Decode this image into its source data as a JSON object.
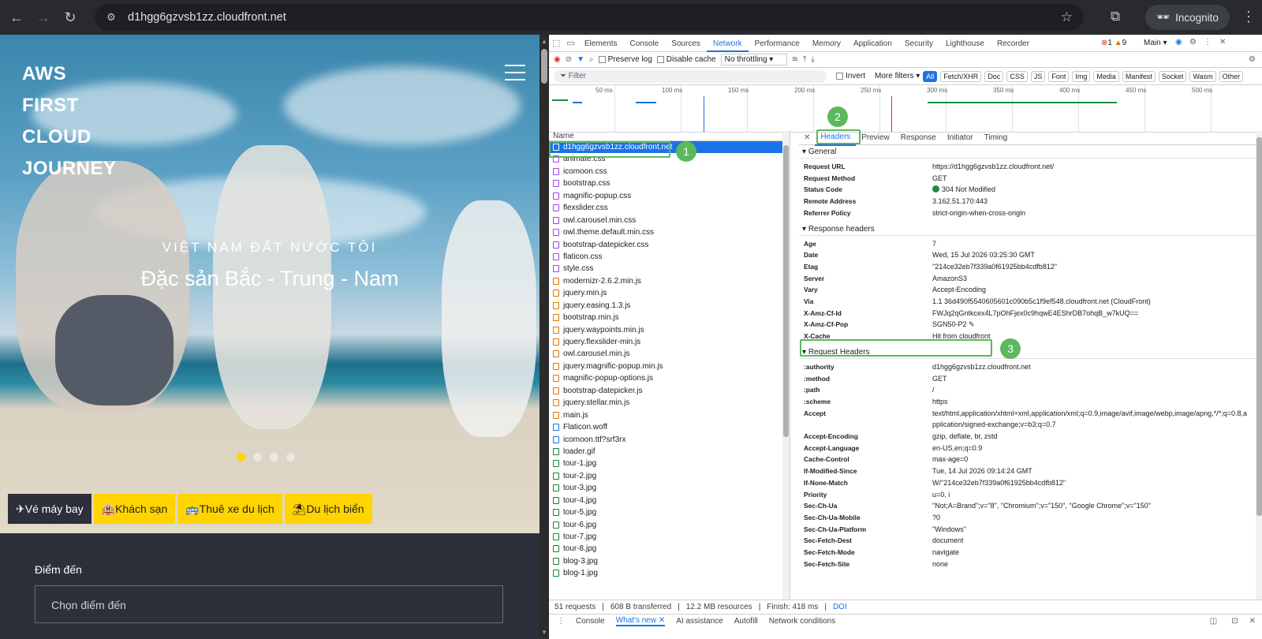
{
  "browser": {
    "url": "d1hgg6gzvsb1zz.cloudfront.net",
    "incognito_label": "Incognito"
  },
  "page": {
    "logo_lines": [
      "AWS",
      "FIRST",
      "CLOUD",
      "JOURNEY"
    ],
    "tagline": "VIỆT NAM ĐẤT NƯỚC TÔI",
    "hero_title": "Đặc sản Bắc - Trung - Nam",
    "tabs": [
      "✈Vé máy bay",
      "🏨Khách sạn",
      "🚌Thuê xe du lịch",
      "⛱Du lịch biển"
    ],
    "form_label": "Điểm đến",
    "form_placeholder": "Chọn điểm đến"
  },
  "devtools": {
    "tabs": [
      "Elements",
      "Console",
      "Sources",
      "Network",
      "Performance",
      "Memory",
      "Application",
      "Security",
      "Lighthouse",
      "Recorder"
    ],
    "errors": "1",
    "warnings": "9",
    "context": "Main",
    "toolbar": {
      "preserve_log": "Preserve log",
      "disable_cache": "Disable cache",
      "throttling": "No throttling"
    },
    "filter": {
      "placeholder": "Filter",
      "invert": "Invert",
      "more_filters": "More filters",
      "types": [
        "All",
        "Fetch/XHR",
        "Doc",
        "CSS",
        "JS",
        "Font",
        "Img",
        "Media",
        "Manifest",
        "Socket",
        "Wasm",
        "Other"
      ]
    },
    "ticks": [
      "50 ms",
      "100 ms",
      "150 ms",
      "200 ms",
      "250 ms",
      "300 ms",
      "350 ms",
      "400 ms",
      "450 ms",
      "500 ms"
    ],
    "list_header": "Name",
    "requests": [
      {
        "name": "d1hgg6gzvsb1zz.cloudfront.net",
        "type": "doc"
      },
      {
        "name": "animate.css",
        "type": "css"
      },
      {
        "name": "icomoon.css",
        "type": "css"
      },
      {
        "name": "bootstrap.css",
        "type": "css"
      },
      {
        "name": "magnific-popup.css",
        "type": "css"
      },
      {
        "name": "flexslider.css",
        "type": "css"
      },
      {
        "name": "owl.carousel.min.css",
        "type": "css"
      },
      {
        "name": "owl.theme.default.min.css",
        "type": "css"
      },
      {
        "name": "bootstrap-datepicker.css",
        "type": "css"
      },
      {
        "name": "flaticon.css",
        "type": "css"
      },
      {
        "name": "style.css",
        "type": "css"
      },
      {
        "name": "modernizr-2.6.2.min.js",
        "type": "js"
      },
      {
        "name": "jquery.min.js",
        "type": "js"
      },
      {
        "name": "jquery.easing.1.3.js",
        "type": "js"
      },
      {
        "name": "bootstrap.min.js",
        "type": "js"
      },
      {
        "name": "jquery.waypoints.min.js",
        "type": "js"
      },
      {
        "name": "jquery.flexslider-min.js",
        "type": "js"
      },
      {
        "name": "owl.carousel.min.js",
        "type": "js"
      },
      {
        "name": "jquery.magnific-popup.min.js",
        "type": "js"
      },
      {
        "name": "magnific-popup-options.js",
        "type": "js"
      },
      {
        "name": "bootstrap-datepicker.js",
        "type": "js"
      },
      {
        "name": "jquery.stellar.min.js",
        "type": "js"
      },
      {
        "name": "main.js",
        "type": "js"
      },
      {
        "name": "Flaticon.woff",
        "type": "font"
      },
      {
        "name": "icomoon.ttf?srf3rx",
        "type": "font"
      },
      {
        "name": "loader.gif",
        "type": "img"
      },
      {
        "name": "tour-1.jpg",
        "type": "img"
      },
      {
        "name": "tour-2.jpg",
        "type": "img"
      },
      {
        "name": "tour-3.jpg",
        "type": "img"
      },
      {
        "name": "tour-4.jpg",
        "type": "img"
      },
      {
        "name": "tour-5.jpg",
        "type": "img"
      },
      {
        "name": "tour-6.jpg",
        "type": "img"
      },
      {
        "name": "tour-7.jpg",
        "type": "img"
      },
      {
        "name": "tour-8.jpg",
        "type": "img"
      },
      {
        "name": "blog-3.jpg",
        "type": "img"
      },
      {
        "name": "blog-1.jpg",
        "type": "img"
      }
    ],
    "detail_tabs": [
      "Headers",
      "Preview",
      "Response",
      "Initiator",
      "Timing"
    ],
    "general_title": "General",
    "general": [
      {
        "k": "Request URL",
        "v": "https://d1hgg6gzvsb1zz.cloudfront.net/"
      },
      {
        "k": "Request Method",
        "v": "GET"
      },
      {
        "k": "Status Code",
        "v": "304 Not Modified"
      },
      {
        "k": "Remote Address",
        "v": "3.162.51.170:443"
      },
      {
        "k": "Referrer Policy",
        "v": "strict-origin-when-cross-origin"
      }
    ],
    "response_title": "Response headers",
    "response": [
      {
        "k": "Age",
        "v": "7"
      },
      {
        "k": "Date",
        "v": "Wed, 15 Jul 2026 03:25:30 GMT"
      },
      {
        "k": "Etag",
        "v": "\"214ce32eb7f339a0f61925bb4cdfb812\""
      },
      {
        "k": "Server",
        "v": "AmazonS3"
      },
      {
        "k": "Vary",
        "v": "Accept-Encoding"
      },
      {
        "k": "Via",
        "v": "1.1 36d490f5540605601c090b5c1f9ef548.cloudfront.net (CloudFront)"
      },
      {
        "k": "X-Amz-Cf-Id",
        "v": "FWJq2qGntkcex4L7pOhFjex0c9hqwE4EShrDB7ohqB_w7kUQ=="
      },
      {
        "k": "X-Amz-Cf-Pop",
        "v": "SGN50-P2"
      },
      {
        "k": "X-Cache",
        "v": "Hit from cloudfront"
      }
    ],
    "request_title": "Request Headers",
    "request": [
      {
        "k": ":authority",
        "v": "d1hgg6gzvsb1zz.cloudfront.net"
      },
      {
        "k": ":method",
        "v": "GET"
      },
      {
        "k": ":path",
        "v": "/"
      },
      {
        "k": ":scheme",
        "v": "https"
      },
      {
        "k": "Accept",
        "v": "text/html,application/xhtml+xml,application/xml;q=0.9,image/avif,image/webp,image/apng,*/*;q=0.8,application/signed-exchange;v=b3;q=0.7"
      },
      {
        "k": "Accept-Encoding",
        "v": "gzip, deflate, br, zstd"
      },
      {
        "k": "Accept-Language",
        "v": "en-US,en;q=0.9"
      },
      {
        "k": "Cache-Control",
        "v": "max-age=0"
      },
      {
        "k": "If-Modified-Since",
        "v": "Tue, 14 Jul 2026 09:14:24 GMT"
      },
      {
        "k": "If-None-Match",
        "v": "W/\"214ce32eb7f339a0f61925bb4cdfb812\""
      },
      {
        "k": "Priority",
        "v": "u=0, i"
      },
      {
        "k": "Sec-Ch-Ua",
        "v": "\"Not;A=Brand\";v=\"8\", \"Chromium\";v=\"150\", \"Google Chrome\";v=\"150\""
      },
      {
        "k": "Sec-Ch-Ua-Mobile",
        "v": "?0"
      },
      {
        "k": "Sec-Ch-Ua-Platform",
        "v": "\"Windows\""
      },
      {
        "k": "Sec-Fetch-Dest",
        "v": "document"
      },
      {
        "k": "Sec-Fetch-Mode",
        "v": "navigate"
      },
      {
        "k": "Sec-Fetch-Site",
        "v": "none"
      }
    ],
    "status": {
      "requests": "51 requests",
      "transferred": "608 B transferred",
      "resources": "12.2 MB resources",
      "finish": "Finish: 418 ms",
      "dom": "DOI"
    },
    "drawer_tabs": [
      "Console",
      "What's new",
      "AI assistance",
      "Autofill",
      "Network conditions"
    ],
    "badges": [
      "1",
      "2",
      "3"
    ]
  },
  "colors": {
    "accent": "#1a73e8",
    "highlight": "#5cb85c",
    "tab_yellow": "#ffd400"
  }
}
